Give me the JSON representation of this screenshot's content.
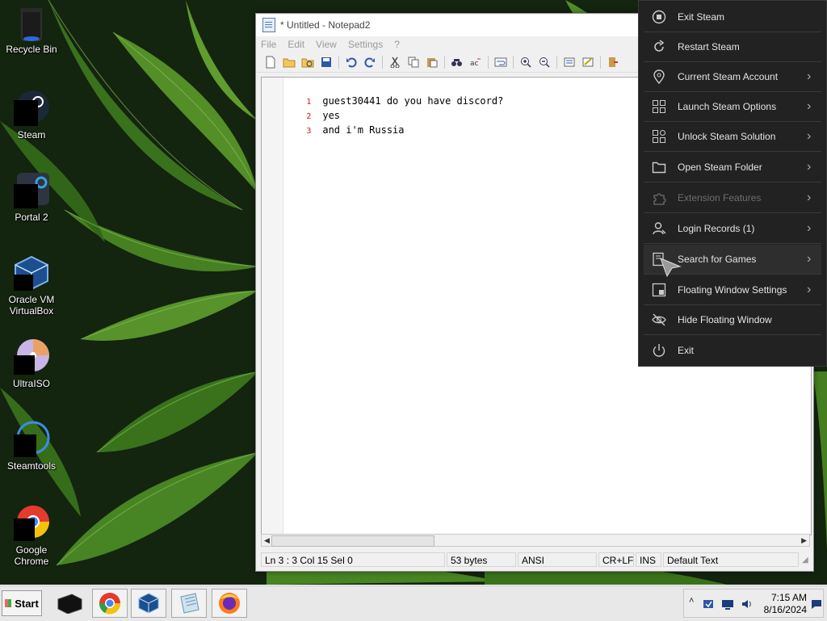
{
  "desktop": {
    "icons": [
      {
        "label": "Recycle Bin"
      },
      {
        "label": "Steam"
      },
      {
        "label": "Portal 2"
      },
      {
        "label": "Oracle VM VirtualBox"
      },
      {
        "label": "UltraISO"
      },
      {
        "label": "Steamtools"
      },
      {
        "label": "Google Chrome"
      }
    ]
  },
  "notepad": {
    "title": "* Untitled - Notepad2",
    "menu": [
      "File",
      "Edit",
      "View",
      "Settings",
      "?"
    ],
    "lines": [
      {
        "num": "1",
        "text": "guest30441 do you have discord?"
      },
      {
        "num": "2",
        "text": "yes"
      },
      {
        "num": "3",
        "text": "and i'm Russia"
      }
    ],
    "status": {
      "position": "Ln 3 : 3   Col 15   Sel 0",
      "size": "53 bytes",
      "encoding": "ANSI",
      "line_ending": "CR+LF",
      "mode": "INS",
      "scheme": "Default Text"
    }
  },
  "steam_menu": {
    "items": [
      {
        "label": "Exit Steam",
        "icon": "stop-circle-icon"
      },
      {
        "label": "Restart Steam",
        "icon": "refresh-icon"
      },
      {
        "label": "Current Steam Account",
        "icon": "location-pin-icon",
        "submenu": true
      },
      {
        "label": "Launch Steam Options",
        "icon": "grid-options-icon",
        "submenu": true
      },
      {
        "label": "Unlock Steam Solution",
        "icon": "apps-grid-icon",
        "submenu": true
      },
      {
        "label": "Open Steam Folder",
        "icon": "folder-icon",
        "submenu": true
      },
      {
        "label": "Extension Features",
        "icon": "puzzle-icon",
        "submenu": true,
        "disabled": true
      },
      {
        "label": "Login Records (1)",
        "icon": "user-icon",
        "submenu": true
      },
      {
        "label": "Search for Games",
        "icon": "search-doc-icon",
        "submenu": true,
        "hovered": true
      },
      {
        "label": "Floating Window Settings",
        "icon": "window-settings-icon",
        "submenu": true
      },
      {
        "label": "Hide Floating Window",
        "icon": "eye-off-icon"
      },
      {
        "label": "Exit",
        "icon": "power-icon"
      }
    ]
  },
  "taskbar": {
    "start_label": "Start",
    "apps": [
      "Steamtools",
      "Google Chrome",
      "Oracle VM VirtualBox",
      "Notepad2",
      "Firefox"
    ],
    "clock_time": "7:15 AM",
    "clock_date": "8/16/2024"
  },
  "colors": {
    "menu_bg": "#222222",
    "menu_text": "#e4e4e4",
    "line_number": "#dd1111",
    "taskbar_bg": "#e8e8e8"
  }
}
